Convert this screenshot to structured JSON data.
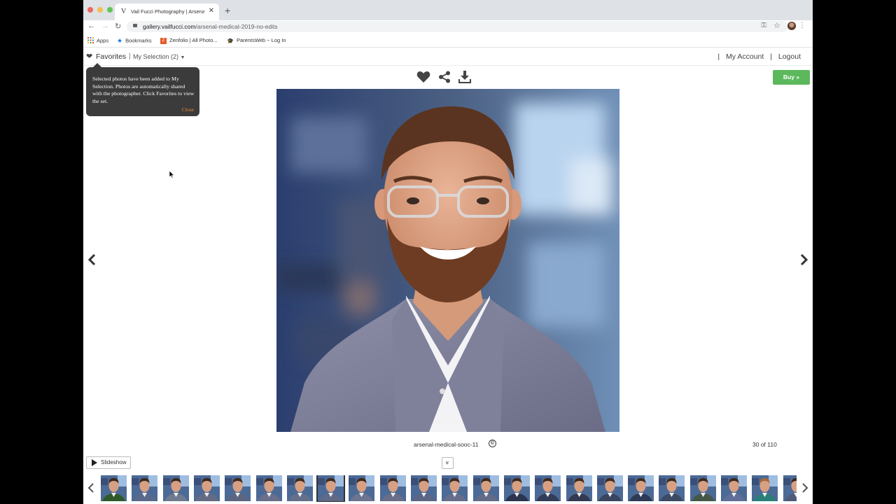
{
  "browser": {
    "tab": {
      "title": "Vail Fucci Photography | Arsenal Medical",
      "favicon_letter": "V"
    },
    "url": {
      "host": "gallery.vailfucci.com",
      "path": "/arsenal-medical-2019-no-edits"
    },
    "bookmarks": [
      {
        "label": "Apps",
        "icon": "apps-grid-icon"
      },
      {
        "label": "Bookmarks",
        "icon": "star-icon"
      },
      {
        "label": "Zenfolio | All Photo...",
        "icon": "zenfolio-icon"
      },
      {
        "label": "ParentsWeb ~ Log In",
        "icon": "cap-icon"
      }
    ]
  },
  "gallery": {
    "favorites_label": "Favorites",
    "separator": "|",
    "my_selection_label": "My Selection (2)",
    "my_account_label": "My Account",
    "logout_label": "Logout",
    "tooltip": {
      "text": "Selected photos have been added to My Selection. Photos are automatically shared with the photographer. Click Favorites to view the set.",
      "close_label": "Close"
    },
    "buy_label": "Buy »",
    "photo_caption": "arsenal-medical-sooc-11",
    "copyright_symbol": "©",
    "counter": "30 of 110",
    "slideshow_label": "Slideshow",
    "collapse_symbol": "»",
    "thumbnail_count": 23,
    "active_thumbnail_index": 7
  },
  "colors": {
    "buy_button": "#5cb85c",
    "tooltip_bg": "#3b3b3b",
    "tooltip_close": "#e88b2f"
  }
}
